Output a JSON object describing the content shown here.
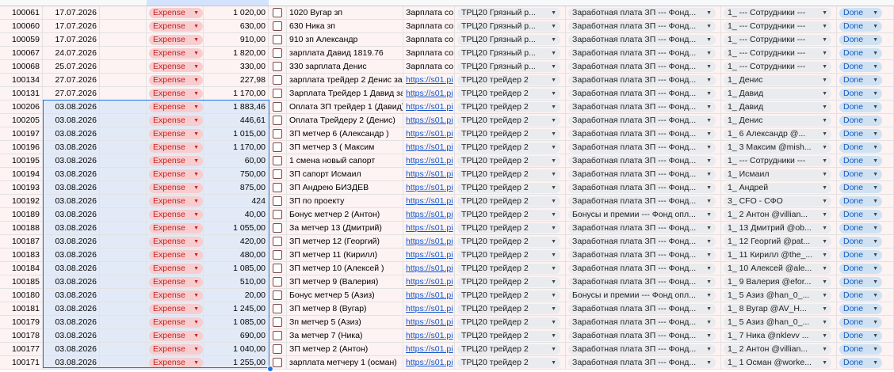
{
  "colors": {
    "expense_bg": "#f7cdd0",
    "expense_text": "#c5221f",
    "done_bg": "#cfe2f3",
    "done_text": "#185abc",
    "row_bg": "#fdf3f3",
    "selection": "#1a73e8"
  },
  "icons": {
    "dropdown": "chevron-down-icon",
    "checkbox": "checkbox-icon"
  },
  "rows": [
    {
      "id": "100061",
      "date": "17.07.2026",
      "type": "Expense",
      "amount": "1 020,00",
      "desc": "1020 Вугар зп",
      "doc": "Зарплата со",
      "link": false,
      "location": "ТРЦ20  Грязный р...",
      "category": "Заработная плата ЗП --- Фонд...",
      "employee": "1_ --- Сотрудники ---",
      "status": "Done"
    },
    {
      "id": "100060",
      "date": "17.07.2026",
      "type": "Expense",
      "amount": "630,00",
      "desc": "630 Ника зп",
      "doc": "Зарплата со",
      "link": false,
      "location": "ТРЦ20  Грязный р...",
      "category": "Заработная плата ЗП --- Фонд...",
      "employee": "1_ --- Сотрудники ---",
      "status": "Done"
    },
    {
      "id": "100059",
      "date": "17.07.2026",
      "type": "Expense",
      "amount": "910,00",
      "desc": "910 зп Александр",
      "doc": "Зарплата со",
      "link": false,
      "location": "ТРЦ20  Грязный р...",
      "category": "Заработная плата ЗП --- Фонд...",
      "employee": "1_ --- Сотрудники ---",
      "status": "Done"
    },
    {
      "id": "100067",
      "date": "24.07.2026",
      "type": "Expense",
      "amount": "1 820,00",
      "desc": "зарплата Давид 1819.76",
      "doc": "Зарплата со",
      "link": false,
      "location": "ТРЦ20  Грязный р...",
      "category": "Заработная плата ЗП --- Фонд...",
      "employee": "1_ --- Сотрудники ---",
      "status": "Done"
    },
    {
      "id": "100068",
      "date": "25.07.2026",
      "type": "Expense",
      "amount": "330,00",
      "desc": "330 зарплата Денис",
      "doc": "Зарплата со",
      "link": false,
      "location": "ТРЦ20  Грязный р...",
      "category": "Заработная плата ЗП --- Фонд...",
      "employee": "1_ --- Сотрудники ---",
      "status": "Done"
    },
    {
      "id": "100134",
      "date": "27.07.2026",
      "type": "Expense",
      "amount": "227,98",
      "desc": "зарплата трейдер 2 Денис за",
      "doc": "https://s01.pi",
      "link": true,
      "location": "ТРЦ20  трейдер 2",
      "category": "Заработная плата ЗП --- Фонд...",
      "employee": "1_ Денис",
      "status": "Done"
    },
    {
      "id": "100131",
      "date": "27.07.2026",
      "type": "Expense",
      "amount": "1 170,00",
      "desc": "Зарплата Трейдер 1 Давид за",
      "doc": "https://s01.pi",
      "link": true,
      "location": "ТРЦ20  трейдер 2",
      "category": "Заработная плата ЗП --- Фонд...",
      "employee": "1_ Давид",
      "status": "Done"
    },
    {
      "id": "100206",
      "date": "03.08.2026",
      "type": "Expense",
      "amount": "1 883,46",
      "desc": "Оплата ЗП трейдер 1 (Давид)",
      "doc": "https://s01.pi",
      "link": true,
      "location": "ТРЦ20  трейдер 2",
      "category": "Заработная плата ЗП --- Фонд...",
      "employee": "1_ Давид",
      "status": "Done"
    },
    {
      "id": "100205",
      "date": "03.08.2026",
      "type": "Expense",
      "amount": "446,61",
      "desc": "Оплата Трейдеру 2 (Денис)",
      "doc": "https://s01.pi",
      "link": true,
      "location": "ТРЦ20  трейдер 2",
      "category": "Заработная плата ЗП --- Фонд...",
      "employee": "1_ Денис",
      "status": "Done"
    },
    {
      "id": "100197",
      "date": "03.08.2026",
      "type": "Expense",
      "amount": "1 015,00",
      "desc": "ЗП метчер 6 (Александр )",
      "doc": "https://s01.pi",
      "link": true,
      "location": "ТРЦ20  трейдер 2",
      "category": "Заработная плата ЗП --- Фонд...",
      "employee": "1_ 6 Александр  @...",
      "status": "Done"
    },
    {
      "id": "100196",
      "date": "03.08.2026",
      "type": "Expense",
      "amount": "1 170,00",
      "desc": "ЗП метчер 3 ( Максим",
      "doc": "https://s01.pi",
      "link": true,
      "location": "ТРЦ20  трейдер 2",
      "category": "Заработная плата ЗП --- Фонд...",
      "employee": "1_ 3 Максим @mish...",
      "status": "Done"
    },
    {
      "id": "100195",
      "date": "03.08.2026",
      "type": "Expense",
      "amount": "60,00",
      "desc": "1 смена новый сапорт",
      "doc": "https://s01.pi",
      "link": true,
      "location": "ТРЦ20  трейдер 2",
      "category": "Заработная плата ЗП --- Фонд...",
      "employee": "1_ --- Сотрудники ---",
      "status": "Done"
    },
    {
      "id": "100194",
      "date": "03.08.2026",
      "type": "Expense",
      "amount": "750,00",
      "desc": "ЗП сапорт Исмаил",
      "doc": "https://s01.pi",
      "link": true,
      "location": "ТРЦ20  трейдер 2",
      "category": "Заработная плата ЗП --- Фонд...",
      "employee": "1_ Исмаил",
      "status": "Done"
    },
    {
      "id": "100193",
      "date": "03.08.2026",
      "type": "Expense",
      "amount": "875,00",
      "desc": "ЗП Андрею БИЗДЕВ",
      "doc": "https://s01.pi",
      "link": true,
      "location": "ТРЦ20  трейдер 2",
      "category": "Заработная плата ЗП --- Фонд...",
      "employee": "1_ Андрей",
      "status": "Done"
    },
    {
      "id": "100192",
      "date": "03.08.2026",
      "type": "Expense",
      "amount": "424",
      "desc": "ЗП по проекту",
      "doc": "https://s01.pi",
      "link": true,
      "location": "ТРЦ20  трейдер 2",
      "category": "Заработная плата ЗП --- Фонд...",
      "employee": "3_ CFO - СФО",
      "status": "Done"
    },
    {
      "id": "100189",
      "date": "03.08.2026",
      "type": "Expense",
      "amount": "40,00",
      "desc": "Бонус метчер 2  (Антон)",
      "doc": "https://s01.pi",
      "link": true,
      "location": "ТРЦ20  трейдер 2",
      "category": "Бонусы и премии --- Фонд опл...",
      "employee": "1_ 2 Антон  @villian...",
      "status": "Done"
    },
    {
      "id": "100188",
      "date": "03.08.2026",
      "type": "Expense",
      "amount": "1 055,00",
      "desc": "За метчер 13 (Дмитрий)",
      "doc": "https://s01.pi",
      "link": true,
      "location": "ТРЦ20  трейдер 2",
      "category": "Заработная плата ЗП --- Фонд...",
      "employee": "1_ 13 Дмитрий @ob...",
      "status": "Done"
    },
    {
      "id": "100187",
      "date": "03.08.2026",
      "type": "Expense",
      "amount": "420,00",
      "desc": "ЗП метчер 12 (Георгий)",
      "doc": "https://s01.pi",
      "link": true,
      "location": "ТРЦ20  трейдер 2",
      "category": "Заработная плата ЗП --- Фонд...",
      "employee": "1_ 12 Георгий  @pat...",
      "status": "Done"
    },
    {
      "id": "100183",
      "date": "03.08.2026",
      "type": "Expense",
      "amount": "480,00",
      "desc": "ЗП метчер 11 (Кирилл)",
      "doc": "https://s01.pi",
      "link": true,
      "location": "ТРЦ20  трейдер 2",
      "category": "Заработная плата ЗП --- Фонд...",
      "employee": "1_ 11 Кирилл @the_...",
      "status": "Done"
    },
    {
      "id": "100184",
      "date": "03.08.2026",
      "type": "Expense",
      "amount": "1 085,00",
      "desc": "ЗП метчер 10 (Алексей )",
      "doc": "https://s01.pi",
      "link": true,
      "location": "ТРЦ20  трейдер 2",
      "category": "Заработная плата ЗП --- Фонд...",
      "employee": "1_ 10 Алексей @ale...",
      "status": "Done"
    },
    {
      "id": "100185",
      "date": "03.08.2026",
      "type": "Expense",
      "amount": "510,00",
      "desc": "ЗП метчер 9 (Валерия)",
      "doc": "https://s01.pi",
      "link": true,
      "location": "ТРЦ20  трейдер 2",
      "category": "Заработная плата ЗП --- Фонд...",
      "employee": "1_ 9 Валерия @efor...",
      "status": "Done"
    },
    {
      "id": "100180",
      "date": "03.08.2026",
      "type": "Expense",
      "amount": "20,00",
      "desc": "Бонус метчер 5 (Азиз)",
      "doc": "https://s01.pi",
      "link": true,
      "location": "ТРЦ20  трейдер 2",
      "category": "Бонусы и премии --- Фонд опл...",
      "employee": "1_ 5 Азиз @han_0_...",
      "status": "Done"
    },
    {
      "id": "100181",
      "date": "03.08.2026",
      "type": "Expense",
      "amount": "1 245,00",
      "desc": " ЗП метчер 8 (Вугар)",
      "doc": "https://s01.pi",
      "link": true,
      "location": "ТРЦ20  трейдер 2",
      "category": "Заработная плата ЗП --- Фонд...",
      "employee": "1_ 8 Вугар  @AV_H...",
      "status": "Done"
    },
    {
      "id": "100179",
      "date": "03.08.2026",
      "type": "Expense",
      "amount": "1 085,00",
      "desc": "Зп метчер 5 (Азиз)",
      "doc": " https://s01.pi",
      "link": true,
      "location": "ТРЦ20  трейдер 2",
      "category": "Заработная плата ЗП --- Фонд...",
      "employee": "1_ 5 Азиз @han_0_...",
      "status": "Done"
    },
    {
      "id": "100178",
      "date": "03.08.2026",
      "type": "Expense",
      "amount": "690,00",
      "desc": "За метчер 7 (Ника)",
      "doc": "https://s01.pi",
      "link": true,
      "location": "ТРЦ20  трейдер 2",
      "category": "Заработная плата ЗП --- Фонд...",
      "employee": "1_ 7 Ника @nklevv ...",
      "status": "Done"
    },
    {
      "id": "100177",
      "date": "03.08.2026",
      "type": "Expense",
      "amount": "1 040,00",
      "desc": "ЗП метчер 2 (Антон)",
      "doc": "https://s01.pi",
      "link": true,
      "location": "ТРЦ20  трейдер 2",
      "category": "Заработная плата ЗП --- Фонд...",
      "employee": "1_ 2 Антон  @villian...",
      "status": "Done"
    },
    {
      "id": "100171",
      "date": "03.08.2026",
      "type": "Expense",
      "amount": "1 255,00",
      "desc": "зарплата метчеру 1 (осман)",
      "doc": "https://s01.pi",
      "link": true,
      "location": "ТРЦ20  трейдер 2",
      "category": "Заработная плата ЗП --- Фонд...",
      "employee": "1_ 1 Осман @worke...",
      "status": "Done"
    }
  ]
}
